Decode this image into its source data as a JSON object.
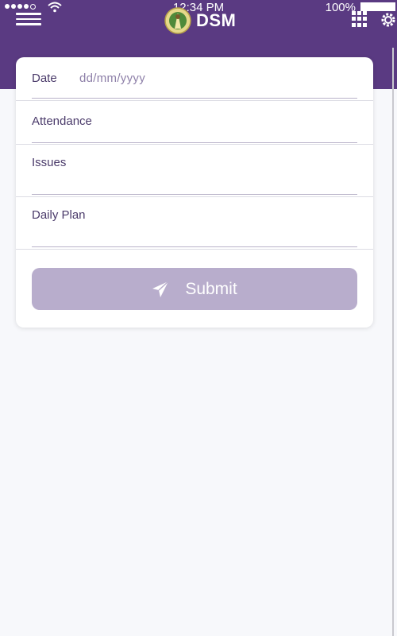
{
  "status_bar": {
    "time": "12:34 PM",
    "battery": "100%",
    "signal_bars": 4
  },
  "header": {
    "title": "DSM",
    "background_color": "#5a3a82",
    "icons": [
      "menu-icon",
      "app-logo",
      "grid-menu-icon",
      "gear-icon"
    ]
  },
  "form": {
    "date": {
      "label": "Date",
      "placeholder": "dd/mm/yyyy",
      "value": ""
    },
    "attendance": {
      "label": "Attendance",
      "value": ""
    },
    "issues": {
      "label": "Issues",
      "value": ""
    },
    "daily_plan": {
      "label": "Daily Plan",
      "value": ""
    },
    "submit": {
      "label": "Submit",
      "icon": "send-icon",
      "color": "#b8adcc"
    }
  }
}
